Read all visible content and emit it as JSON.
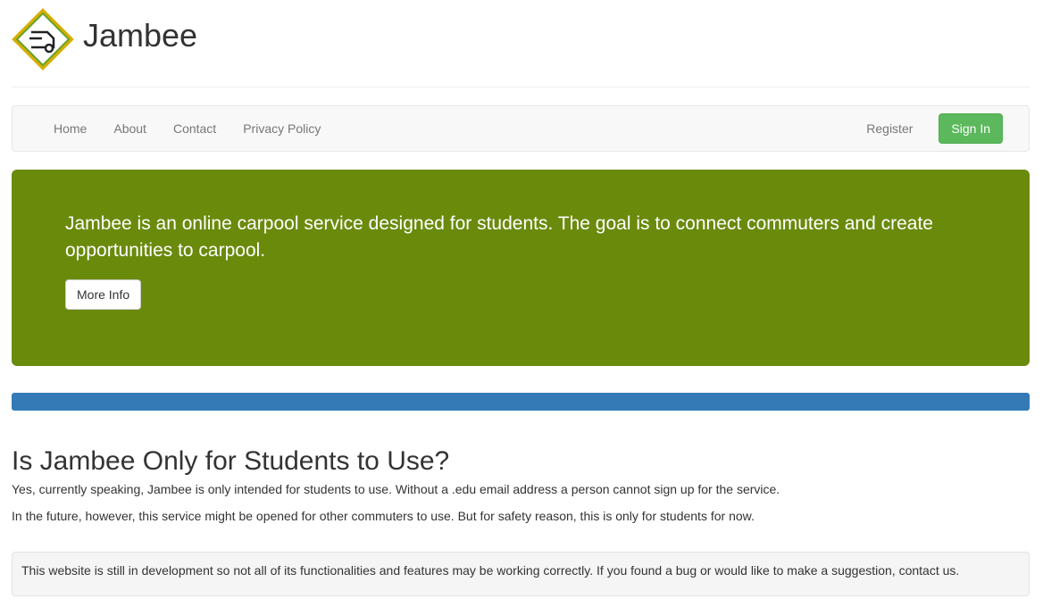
{
  "brand": {
    "title": "Jambee",
    "logo_icon": "car-diamond-logo"
  },
  "nav": {
    "links": [
      "Home",
      "About",
      "Contact",
      "Privacy Policy"
    ],
    "register_label": "Register",
    "signin_label": "Sign In"
  },
  "jumbotron": {
    "text": "Jambee is an online carpool service designed for students. The goal is to connect commuters and create opportunities to carpool.",
    "button_label": "More Info"
  },
  "faq": {
    "title": "Is Jambee Only for Students to Use?",
    "paragraphs": [
      "Yes, currently speaking, Jambee is only intended for students to use. Without a .edu email address a person cannot sign up for the service.",
      "In the future, however, this service might be opened for other commuters to use. But for safety reason, this is only for students for now."
    ]
  },
  "notice": {
    "text": "This website is still in development so not all of its functionalities and features may be working correctly. If you found a bug or would like to make a suggestion, contact us."
  },
  "colors": {
    "jumbotron": "#6a8a0c",
    "signin": "#5cb85c",
    "bar": "#337ab7"
  }
}
